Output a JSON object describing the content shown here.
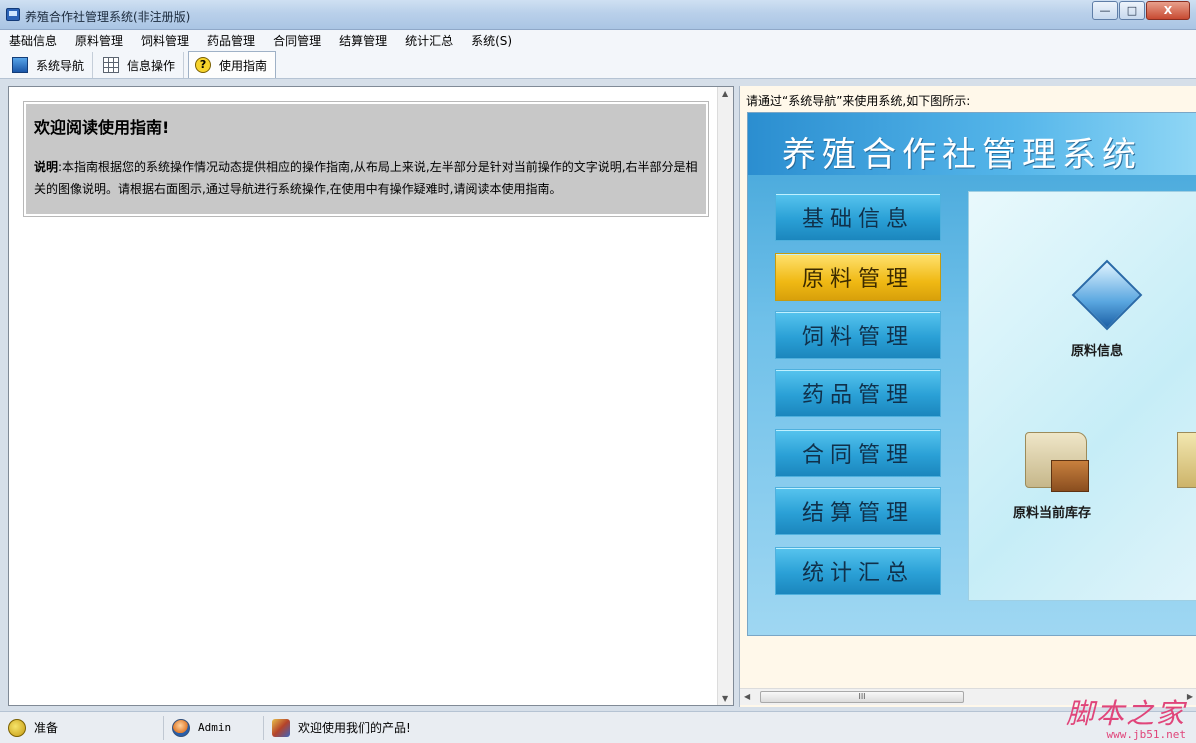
{
  "window": {
    "title": "养殖合作社管理系统(非注册版)",
    "minimize": "—",
    "maximize": "□",
    "close": "X"
  },
  "menu": [
    "基础信息",
    "原料管理",
    "饲料管理",
    "药品管理",
    "合同管理",
    "结算管理",
    "统计汇总",
    "系统(S)"
  ],
  "tabs": [
    {
      "label": "系统导航",
      "icon": "monitor-icon",
      "active": false
    },
    {
      "label": "信息操作",
      "icon": "grid-icon",
      "active": false
    },
    {
      "label": "使用指南",
      "icon": "help-icon",
      "active": true
    }
  ],
  "guide": {
    "title": "欢迎阅读使用指南!",
    "desc_label": "说明",
    "desc_text": ":本指南根据您的系统操作情况动态提供相应的操作指南,从布局上来说,左半部分是针对当前操作的文字说明,右半部分是相关的图像说明。请根据右面图示,通过导航进行系统操作,在使用中有操作疑难时,请阅读本使用指南。"
  },
  "right": {
    "caption": "请通过“系统导航”来使用系统,如下图所示:",
    "preview_title": "养殖合作社管理系统",
    "nav_buttons": [
      {
        "label": "基础信息",
        "active": false
      },
      {
        "label": "原料管理",
        "active": true
      },
      {
        "label": "饲料管理",
        "active": false
      },
      {
        "label": "药品管理",
        "active": false
      },
      {
        "label": "合同管理",
        "active": false
      },
      {
        "label": "结算管理",
        "active": false
      },
      {
        "label": "统计汇总",
        "active": false
      }
    ],
    "icon_labels": {
      "material_info": "原料信息",
      "material_stock": "原料当前库存"
    },
    "hscroll_thumb": "III"
  },
  "status": {
    "ready": "准备",
    "user": "Admin",
    "welcome": "欢迎使用我们的产品!"
  },
  "watermark": {
    "main": "脚本之家",
    "sub": "www.jb51.net"
  },
  "colors": {
    "nav_button": "#2aa0d6",
    "nav_button_active": "#f0b914",
    "guide_box": "#c8c8c8"
  }
}
